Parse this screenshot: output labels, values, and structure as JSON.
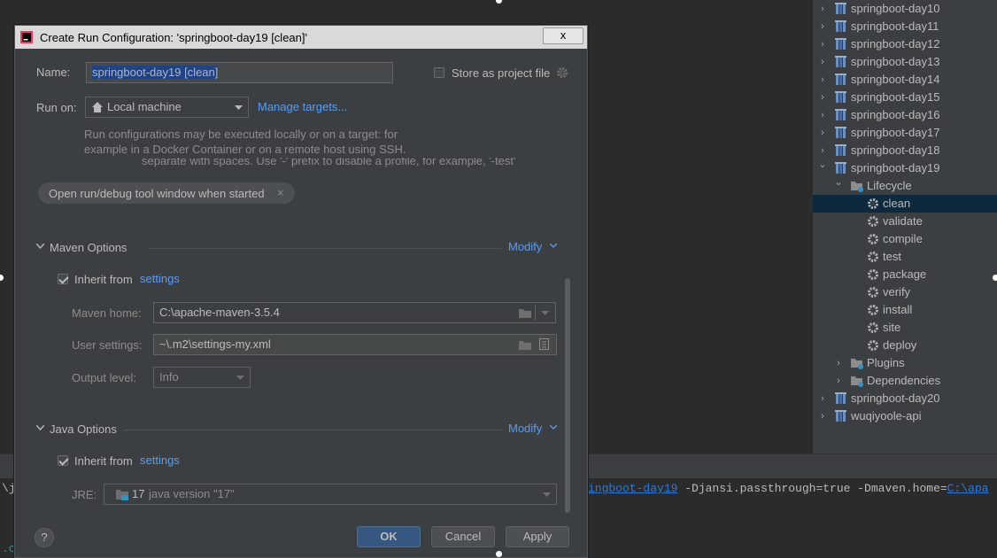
{
  "dialog": {
    "title": "Create Run Configuration: 'springboot-day19 [clean]'",
    "close_label": "x",
    "name_label": "Name:",
    "name_value": "springboot-day19 [clean]",
    "store_label": "Store as project file",
    "runon_label": "Run on:",
    "runon_value": "Local machine",
    "manage_targets": "Manage targets...",
    "hint_line1": "Run configurations may be executed locally or on a target: for",
    "hint_line2": "example in a Docker Container or on a remote host using SSH.",
    "hidden_line": "separate with spaces. Use '-' prefix to disable a profile, for example, '-test'",
    "chip_label": "Open run/debug tool window when started",
    "chip_close": "×",
    "maven_section": "Maven Options",
    "java_section": "Java Options",
    "modify": "Modify",
    "inherit_from": "Inherit from",
    "settings_link": "settings",
    "maven_home_label": "Maven home:",
    "maven_home_value": "C:\\apache-maven-3.5.4",
    "user_settings_label": "User settings:",
    "user_settings_value": "~\\.m2\\settings-my.xml",
    "output_level_label": "Output level:",
    "output_level_value": "Info",
    "jre_label": "JRE:",
    "jre_version": "17",
    "jre_value": "java version \"17\"",
    "help_label": "?",
    "ok_label": "OK",
    "cancel_label": "Cancel",
    "apply_label": "Apply"
  },
  "tree": {
    "projects_top": [
      "springboot-day10",
      "springboot-day11",
      "springboot-day12",
      "springboot-day13",
      "springboot-day14",
      "springboot-day15",
      "springboot-day16",
      "springboot-day17",
      "springboot-day18",
      "springboot-day19"
    ],
    "lifecycle_label": "Lifecycle",
    "goals": [
      "clean",
      "validate",
      "compile",
      "test",
      "package",
      "verify",
      "install",
      "site",
      "deploy"
    ],
    "plugins_label": "Plugins",
    "dependencies_label": "Dependencies",
    "projects_bottom": [
      "springboot-day20",
      "wuqiyoole-api"
    ]
  },
  "console": {
    "left_fragment": "\\j",
    "link1": "ingboot-day19",
    "middle": " -Djansi.passthrough=true -Dmaven.home=",
    "link2": "C:\\apa",
    "bottom_fragment": ".c"
  },
  "colors": {
    "accent": "#589df6",
    "selection": "#0d293e",
    "primary_button": "#365880"
  }
}
